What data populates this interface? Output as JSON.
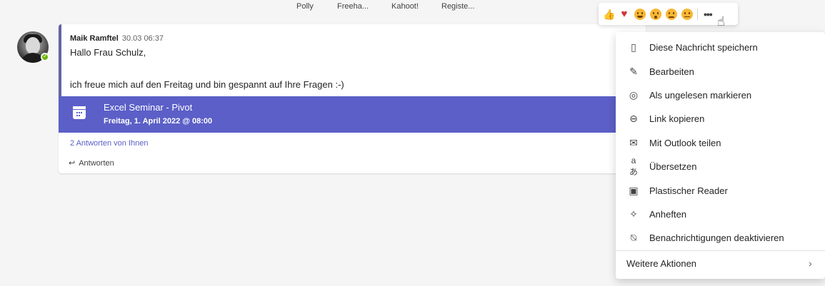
{
  "topbar": {
    "tabs": [
      "Polly",
      "Freeha...",
      "Kahoot!",
      "Registe..."
    ]
  },
  "message": {
    "author": "Maik Ramftel",
    "timestamp": "30.03 06:37",
    "line1": "Hallo Frau Schulz,",
    "line2": "ich freue mich auf den Freitag und bin gespannt auf Ihre Fragen :-)",
    "presence": "available",
    "event": {
      "title": "Excel Seminar - Pivot",
      "date": "Freitag, 1. April 2022 @ 08:00",
      "icon": "calendar-icon"
    },
    "replies_link": "2 Antworten von Ihnen",
    "reply_label": "Antworten"
  },
  "reactions": {
    "items": [
      "like",
      "heart",
      "laugh",
      "surprised",
      "sad",
      "angry"
    ],
    "more_icon": "more-options-icon"
  },
  "menu": {
    "items": [
      {
        "label": "Diese Nachricht speichern",
        "icon": "bookmark-icon"
      },
      {
        "label": "Bearbeiten",
        "icon": "pencil-icon"
      },
      {
        "label": "Als ungelesen markieren",
        "icon": "unread-icon"
      },
      {
        "label": "Link kopieren",
        "icon": "link-icon"
      },
      {
        "label": "Mit Outlook teilen",
        "icon": "mail-icon"
      },
      {
        "label": "Übersetzen",
        "icon": "translate-icon"
      },
      {
        "label": "Plastischer Reader",
        "icon": "immersive-reader-icon"
      },
      {
        "label": "Anheften",
        "icon": "pin-icon"
      },
      {
        "label": "Benachrichtigungen deaktivieren",
        "icon": "bell-off-icon"
      }
    ],
    "more_actions": "Weitere Aktionen"
  },
  "colors": {
    "accent": "#5b5fc7",
    "presence": "#6bb700",
    "heart": "#d13438"
  }
}
